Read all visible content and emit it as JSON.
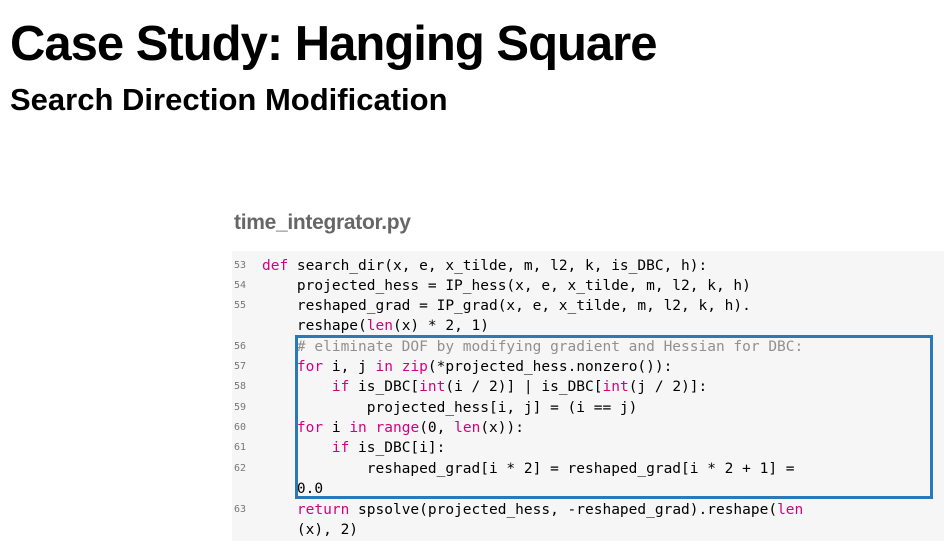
{
  "slide": {
    "title": "Case Study: Hanging Square",
    "subtitle": "Search Direction Modification"
  },
  "code": {
    "filename": "time_integrator.py",
    "line_numbers": [
      "53",
      "54",
      "55",
      "56",
      "57",
      "58",
      "59",
      "60",
      "61",
      "62",
      "63"
    ],
    "lines": {
      "l53_kw": "def",
      "l53_rest": " search_dir(x, e, x_tilde, m, l2, k, is_DBC, h):",
      "l54": "    projected_hess = IP_hess(x, e, x_tilde, m, l2, k, h)",
      "l55a": "    reshaped_grad = IP_grad(x, e, x_tilde, m, l2, k, h).",
      "l55b_pre": "    reshape(",
      "l55b_len": "len",
      "l55b_post": "(x) * 2, 1)",
      "l56": "    # eliminate DOF by modifying gradient and Hessian for DBC:",
      "l57_kw": "for",
      "l57_a": " i, j ",
      "l57_in": "in",
      "l57_sp": " ",
      "l57_zip": "zip",
      "l57_b": "(*projected_hess.nonzero()):",
      "l58_kw": "if",
      "l58_a": " is_DBC[",
      "l58_int1": "int",
      "l58_b": "(i / 2)] | is_DBC[",
      "l58_int2": "int",
      "l58_c": "(j / 2)]:",
      "l59": "            projected_hess[i, j] = (i == j)",
      "l60_kw": "for",
      "l60_a": " i ",
      "l60_in": "in",
      "l60_sp": " ",
      "l60_range": "range",
      "l60_b": "(0, ",
      "l60_len": "len",
      "l60_c": "(x)):",
      "l61_kw": "if",
      "l61_a": " is_DBC[i]:",
      "l62a": "            reshaped_grad[i * 2] = reshaped_grad[i * 2 + 1] =",
      "l62b": "    0.0",
      "l63_kw": "return",
      "l63_a": " spsolve(projected_hess, -reshaped_grad).reshape(",
      "l63_len": "len",
      "l63b": "    (x), 2)"
    }
  },
  "colors": {
    "keyword": "#d40082",
    "comment": "#909090",
    "highlight_border": "#2b79b6",
    "code_background": "#f6f6f6"
  }
}
